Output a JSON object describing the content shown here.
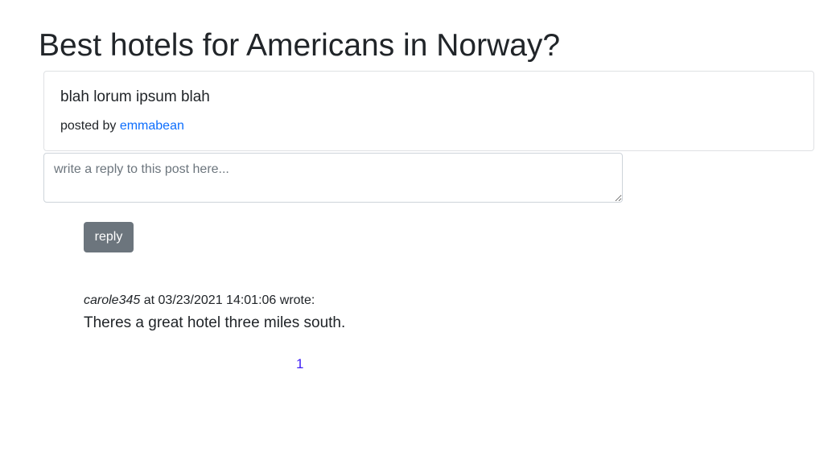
{
  "page": {
    "title": "Best hotels for Americans in Norway?"
  },
  "post": {
    "body": "blah lorum ipsum blah",
    "posted_by_label": "posted by ",
    "author": "emmabean"
  },
  "reply_form": {
    "placeholder": "write a reply to this post here...",
    "value": "",
    "button_label": "reply"
  },
  "comments": [
    {
      "user": "carole345",
      "meta": " at 03/23/2021 14:01:06 wrote:",
      "text": "Theres a great hotel three miles south."
    }
  ],
  "pagination": {
    "pages": [
      "1"
    ]
  },
  "colors": {
    "link": "#0d6efd",
    "pagination_link": "#3d1cf5",
    "button_bg": "#6c757d",
    "text": "#212529"
  }
}
